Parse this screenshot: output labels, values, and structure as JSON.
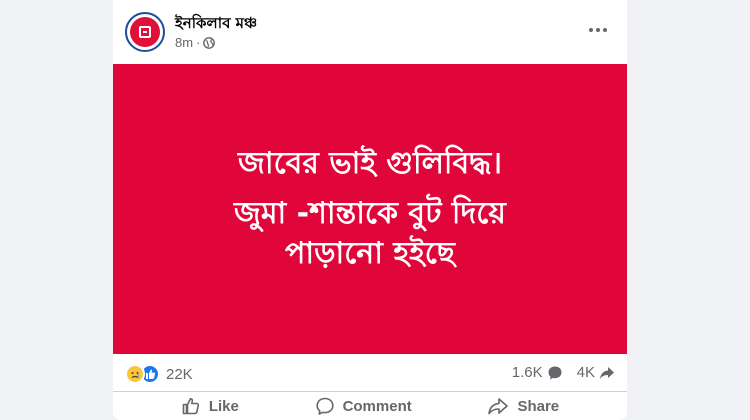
{
  "post": {
    "page_name": "ইনকিলাব মঞ্চ",
    "time": "8m",
    "separator": "·",
    "privacy_icon": "globe-icon"
  },
  "image_text": {
    "line1": "জাবের ভাই গুলিবিদ্ধ।",
    "line2": "জুমা -শান্তাকে বুট দিয়ে",
    "line3": "পাড়ানো হইছে",
    "background_color": "#e0063a"
  },
  "stats": {
    "reaction_count": "22K",
    "comments_count": "1.6K",
    "shares_count": "4K"
  },
  "actions": {
    "like": "Like",
    "comment": "Comment",
    "share": "Share"
  },
  "icons": [
    "avatar",
    "globe-icon",
    "more-options-icon",
    "sad-reaction-icon",
    "like-reaction-icon",
    "comment-bubble-icon",
    "share-arrow-icon",
    "like-thumb-icon",
    "comment-icon",
    "share-icon"
  ]
}
